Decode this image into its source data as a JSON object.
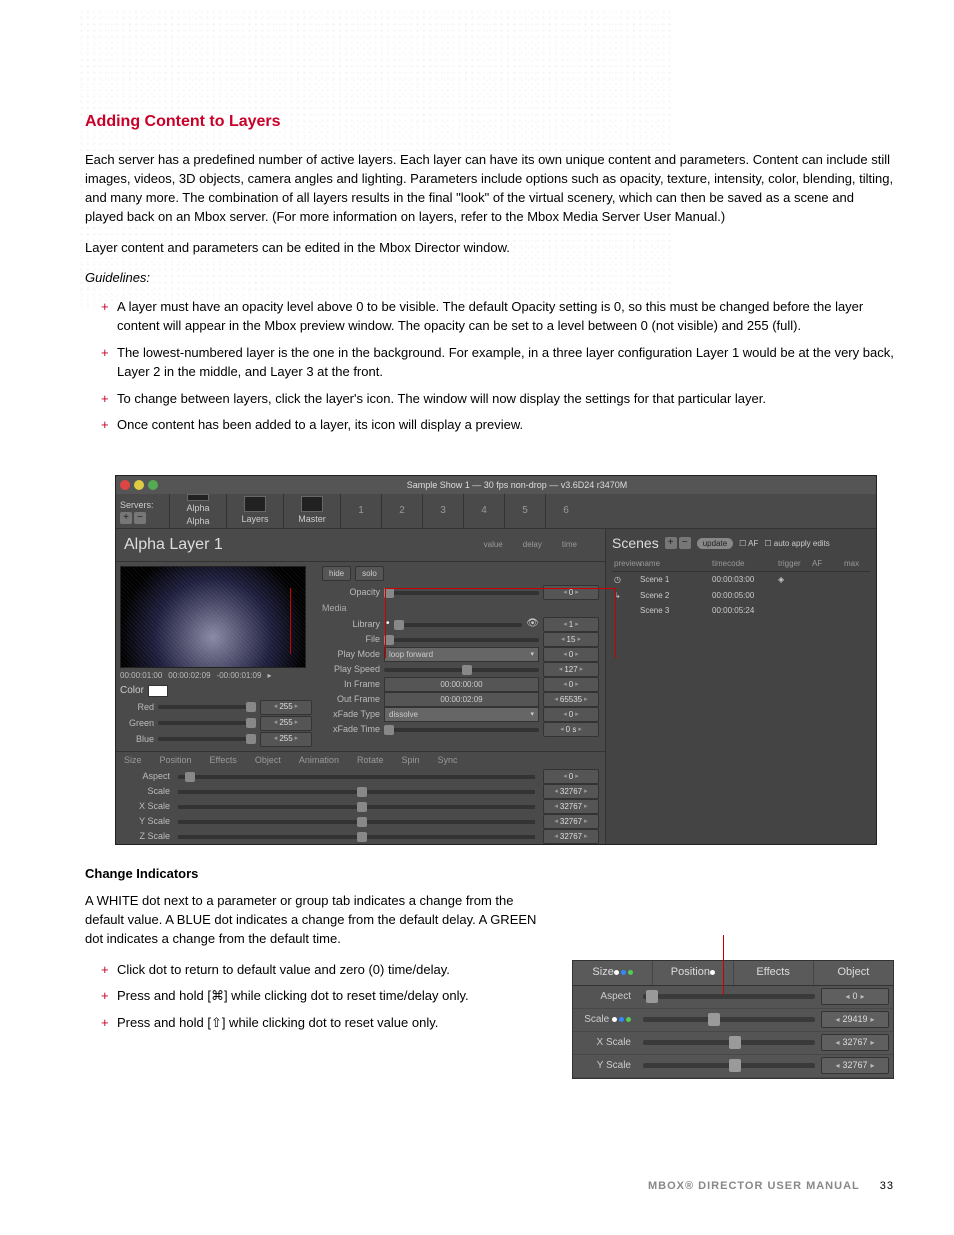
{
  "section_title": "Adding Content to Layers",
  "para1": "Each server has a predefined number of active layers. Each layer can have its own unique content and parameters. Content can include still images, videos, 3D objects, camera angles and lighting. Parameters include options such as opacity, texture, intensity, color, blending, tilting, and many more. The combination of all layers results in the final \"look\" of the virtual scenery, which can then be saved as a scene and played back on an Mbox server. (For more information on layers, refer to the Mbox Media Server User Manual.)",
  "para2": "Layer content and parameters can be edited in the Mbox Director window.",
  "guidelines_label": "Guidelines:",
  "bullets": [
    "A layer must have an opacity level above 0 to be visible. The default Opacity setting is 0, so this must be changed before the layer content will appear in the Mbox preview window. The opacity can be set to a level between 0 (not visible) and 255 (full).",
    "The lowest-numbered layer is the one in the background. For example, in a three layer configuration Layer 1 would be at the very back, Layer 2 in the middle, and Layer 3 at the front.",
    "To change between layers, click the layer's icon. The window will now display the settings for that particular layer.",
    "Once content has been added to a layer, its icon will display a preview."
  ],
  "app": {
    "title": "Sample Show 1  —  30 fps non-drop  —  v3.6D24 r3470M",
    "servers_label": "Servers:",
    "toolbar": {
      "alpha": "Alpha",
      "layers": "Layers",
      "master": "Master"
    },
    "layer_tabs": [
      "1",
      "2",
      "3",
      "4",
      "5",
      "6"
    ],
    "layer_title": "Alpha Layer 1",
    "scenes": {
      "title": "Scenes",
      "update": "update",
      "af": "AF",
      "auto_apply": "auto apply edits",
      "head": {
        "preview": "preview",
        "name": "name",
        "timecode": "timecode",
        "trigger": "trigger",
        "af": "AF",
        "max": "max"
      },
      "rows": [
        {
          "name": "Scene 1",
          "tc": "00:00:03:00"
        },
        {
          "name": "Scene 2",
          "tc": "00:00:05:00"
        },
        {
          "name": "Scene 3",
          "tc": "00:00:05:24"
        }
      ]
    },
    "tc": {
      "a": "00:00:01:00",
      "b": "00:00:02:09",
      "c": "-00:00:01:09"
    },
    "color_section": "Color",
    "rgb": {
      "red": "Red",
      "green": "Green",
      "blue": "Blue",
      "val": "255"
    },
    "btns": {
      "hide": "hide",
      "solo": "solo"
    },
    "value_head": {
      "value": "value",
      "delay": "delay",
      "time": "time"
    },
    "params": {
      "opacity": "Opacity",
      "media": "Media",
      "library": "Library",
      "file": "File",
      "playmode": "Play Mode",
      "playspeed": "Play Speed",
      "inframe": "In Frame",
      "outframe": "Out Frame",
      "xfadetype": "xFade Type",
      "xfadetime": "xFade Time"
    },
    "param_vals": {
      "opacity": "0",
      "library": "1",
      "file": "15",
      "playmode_dd": "loop forward",
      "playmode": "0",
      "playspeed": "127",
      "inframe_tc": "00:00:00:00",
      "inframe": "0",
      "outframe_tc": "00:00:02:09",
      "outframe": "65535",
      "xfadetype_dd": "dissolve",
      "xfadetype": "0",
      "xfadetime": "0 s"
    },
    "tabs_left": [
      "Size",
      "Position",
      "Effects"
    ],
    "tabs_right": [
      "Object",
      "Animation",
      "Rotate",
      "Spin",
      "Sync"
    ],
    "bottom_rows": [
      {
        "lbl": "Aspect",
        "val": "0"
      },
      {
        "lbl": "Scale",
        "val": "32767"
      },
      {
        "lbl": "X Scale",
        "val": "32767"
      },
      {
        "lbl": "Y Scale",
        "val": "32767"
      },
      {
        "lbl": "Z Scale",
        "val": "32767"
      }
    ]
  },
  "ci": {
    "title": "Change Indicators",
    "para": "A WHITE dot next to a parameter or group tab indicates a change from the default value. A BLUE dot indicates a change from the default delay. A GREEN dot indicates a change from the default time.",
    "bullets": [
      "Click dot to return to default value and zero (0) time/delay.",
      "Press and hold [⌘] while clicking dot to reset time/delay only.",
      "Press and hold [⇧] while clicking dot to reset value only."
    ],
    "tabs": [
      "Size",
      "Position",
      "Effects",
      "Object"
    ],
    "rows": [
      {
        "lbl": "Aspect",
        "val": "0",
        "handle": "2%",
        "dots": []
      },
      {
        "lbl": "Scale",
        "val": "29419",
        "handle": "38%",
        "dots": [
          "#fff",
          "#38f",
          "#5c5"
        ]
      },
      {
        "lbl": "X Scale",
        "val": "32767",
        "handle": "50%",
        "dots": []
      },
      {
        "lbl": "Y Scale",
        "val": "32767",
        "handle": "50%",
        "dots": []
      }
    ]
  },
  "footer": {
    "manual": "MBOX® DIRECTOR USER MANUAL",
    "page": "33"
  }
}
